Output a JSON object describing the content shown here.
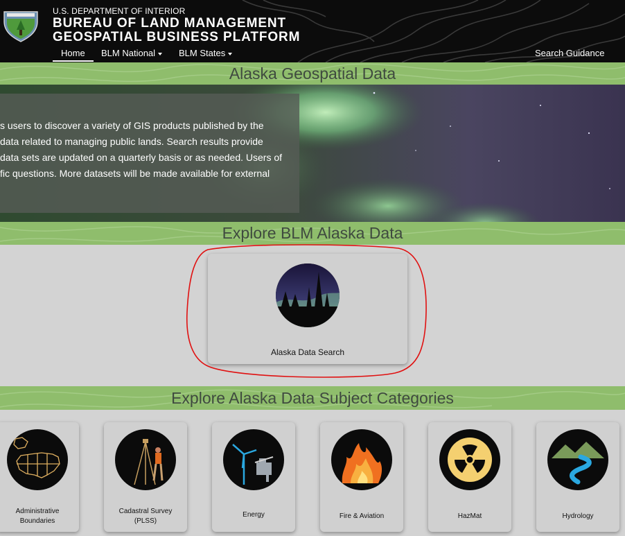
{
  "header": {
    "department": "U.S. DEPARTMENT OF INTERIOR",
    "title_line1": "BUREAU OF LAND MANAGEMENT",
    "title_line2": "GEOSPATIAL BUSINESS PLATFORM",
    "nav": [
      {
        "label": "Home",
        "active": true
      },
      {
        "label": "BLM National",
        "dropdown": true
      },
      {
        "label": "BLM States",
        "dropdown": true
      }
    ],
    "search_guidance": "Search Guidance"
  },
  "page_title": "Alaska Geospatial Data",
  "hero": {
    "lines": [
      "s users to discover a variety of GIS products published by the",
      "data related to managing public lands. Search results provide",
      "data sets are updated on a quarterly basis or as needed. Users of",
      "fic questions. More datasets will be made available for external"
    ]
  },
  "explore_data": {
    "heading": "Explore BLM Alaska Data",
    "card_label": "Alaska Data Search",
    "card_icon": "aurora-forest-icon"
  },
  "categories": {
    "heading": "Explore Alaska Data Subject Categories",
    "items": [
      {
        "line1": "Administrative",
        "line2": "Boundaries",
        "icon": "us-map-icon"
      },
      {
        "line1": "Cadastral Survey",
        "line2": "(PLSS)",
        "icon": "surveyor-icon"
      },
      {
        "line1": "Energy",
        "line2": "",
        "icon": "wind-turbine-icon"
      },
      {
        "line1": "Fire & Aviation",
        "line2": "",
        "icon": "fire-icon"
      },
      {
        "line1": "HazMat",
        "line2": "",
        "icon": "radiation-icon"
      },
      {
        "line1": "Hydrology",
        "line2": "",
        "icon": "river-icon"
      }
    ]
  },
  "colors": {
    "header_bg": "#0c0c0c",
    "band_green": "#8fbd6c",
    "page_bg": "#d3d3d3",
    "highlight_red": "#e01010"
  }
}
